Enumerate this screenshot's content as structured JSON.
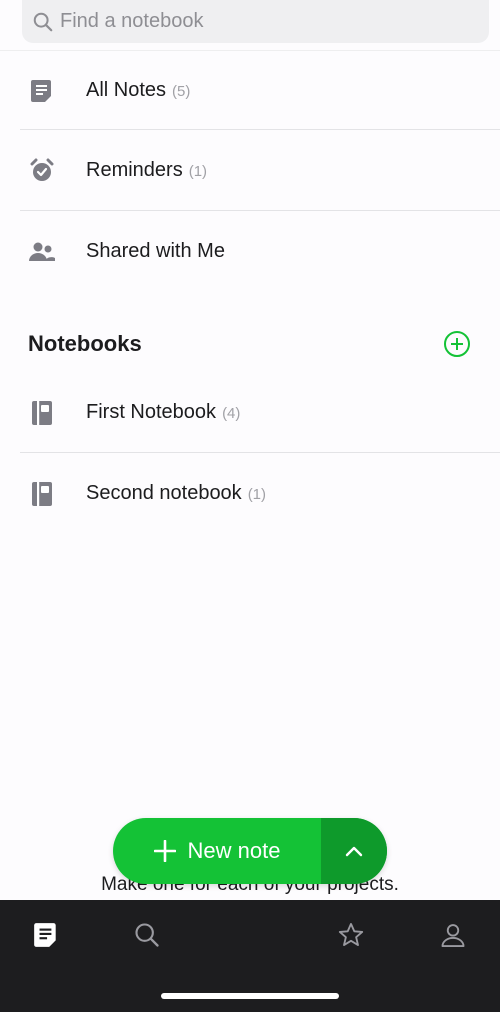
{
  "search": {
    "placeholder": "Find a notebook",
    "icon": "search-icon"
  },
  "shortcuts": [
    {
      "label": "All Notes",
      "count": "(5)",
      "icon": "note-icon"
    },
    {
      "label": "Reminders",
      "count": "(1)",
      "icon": "alarm-clock-icon"
    },
    {
      "label": "Shared with Me",
      "count": "",
      "icon": "people-icon"
    }
  ],
  "notebooks_section": {
    "title": "Notebooks",
    "add_icon": "plus-circle-icon"
  },
  "notebooks": [
    {
      "label": "First Notebook",
      "count": "(4)",
      "icon": "notebook-icon"
    },
    {
      "label": "Second notebook",
      "count": "(1)",
      "icon": "notebook-icon"
    }
  ],
  "fab": {
    "label": "New note",
    "icon": "plus-icon",
    "more_icon": "chevron-up-icon"
  },
  "hint_text": "Make one for each of your projects.",
  "tabbar": [
    {
      "name": "notes",
      "icon": "note-icon",
      "active": true
    },
    {
      "name": "search",
      "icon": "search-icon",
      "active": false
    },
    {
      "name": "shortcuts",
      "icon": "star-icon",
      "active": false
    },
    {
      "name": "account",
      "icon": "person-icon",
      "active": false
    }
  ],
  "colors": {
    "accent": "#14c236",
    "accent_dark": "#0e9a2b",
    "icon_gray": "#7c7c84",
    "tabbar_bg": "#1d1d1f"
  }
}
